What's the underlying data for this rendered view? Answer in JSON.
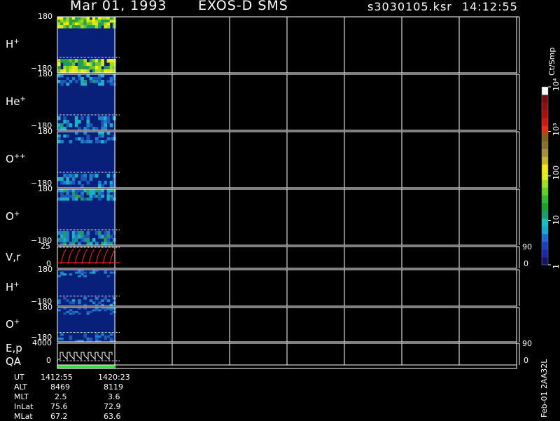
{
  "header": {
    "date": "Mar 01, 1993",
    "instrument": "EXOS-D SMS",
    "file": "s3030105.ksr",
    "time": "14:12:55"
  },
  "panels": [
    {
      "id": "h1",
      "label": "H",
      "sup": "+",
      "ytop": "180",
      "ybot": "−180"
    },
    {
      "id": "he",
      "label": "He",
      "sup": "+",
      "ytop": "180",
      "ybot": "−180"
    },
    {
      "id": "opp",
      "label": "O",
      "sup": "++",
      "ytop": "180",
      "ybot": "−180"
    },
    {
      "id": "o1",
      "label": "O",
      "sup": "+",
      "ytop": "180",
      "ybot": "−180"
    },
    {
      "id": "vr",
      "label": "V,r",
      "sup": "",
      "ytop": "25",
      "ybot": "0",
      "right_top": "90",
      "right_bot": "0"
    },
    {
      "id": "h2",
      "label": "H",
      "sup": "+",
      "ytop": "180",
      "ybot": "−180"
    },
    {
      "id": "o2",
      "label": "O",
      "sup": "+",
      "ytop": "180",
      "ybot": "−180"
    },
    {
      "id": "ep",
      "label": "E,p",
      "label2": "QA",
      "sup": "",
      "ytop": "4000",
      "ybot": "0",
      "right_top": "90",
      "right_bot": "0"
    }
  ],
  "colorbar": {
    "unit": "Ct/Smp",
    "tick_labels": [
      "1",
      "10",
      "100",
      "10³",
      "10⁴"
    ]
  },
  "info": {
    "rows": [
      {
        "label": "UT",
        "v1": "1412:55",
        "v2": "1420:23"
      },
      {
        "label": "ALT",
        "v1": "8469",
        "v2": "8119"
      },
      {
        "label": "MLT",
        "v1": "2.5",
        "v2": "3.6"
      },
      {
        "label": "InLat",
        "v1": "75.6",
        "v2": "72.9"
      },
      {
        "label": "MLat",
        "v1": "67.2",
        "v2": "63.6"
      }
    ]
  },
  "footer_tag": "Feb-01 2AA32L",
  "chart_data": {
    "type": "heatmap",
    "x": [
      "1412:55",
      "1420:23"
    ],
    "panels": [
      "H+",
      "He+",
      "O++",
      "O+",
      "V,r",
      "H+",
      "O+",
      "E,p QA"
    ],
    "angle_range": [
      -180,
      180
    ],
    "vr_range": [
      0,
      25
    ],
    "ep_range": [
      0,
      4000
    ],
    "colorbar_range": [
      1,
      10000
    ],
    "colorbar_scale": "log"
  }
}
